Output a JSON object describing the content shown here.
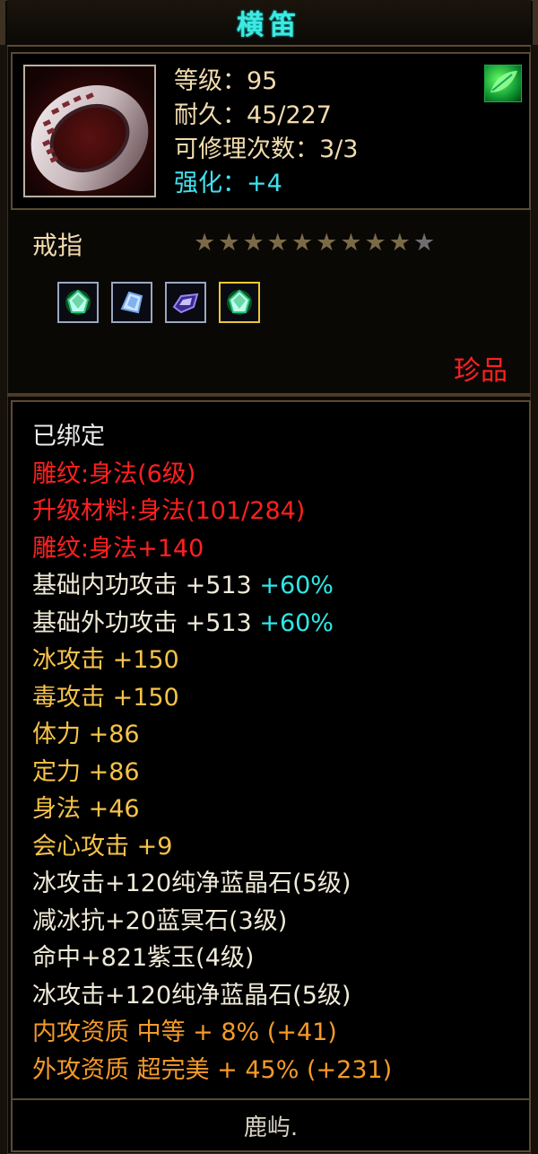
{
  "item": {
    "title": "横笛",
    "stats": [
      {
        "label": "等级",
        "sep": "：",
        "value": "95"
      },
      {
        "label": "耐久",
        "sep": "：",
        "value": "45/227"
      },
      {
        "label": "可修理次数",
        "sep": "：",
        "value": "3/3"
      },
      {
        "label": "强化",
        "sep": "：",
        "value": "+4"
      }
    ],
    "icon": "ring-icon",
    "skill_icon": "leaf-icon",
    "name": "戒指",
    "stars_total": 10,
    "stars_filled": 9,
    "gems": [
      {
        "icon": "green-gem-icon",
        "color": "#2fbf7a",
        "selected": false
      },
      {
        "icon": "blue-crystal-icon",
        "color": "#6fa8e8",
        "selected": false
      },
      {
        "icon": "purple-jade-icon",
        "color": "#6a48c8",
        "selected": false
      },
      {
        "icon": "green-gem-icon",
        "color": "#2fbf7a",
        "selected": true
      }
    ],
    "rarity": "珍品"
  },
  "attributes": [
    {
      "text": "已绑定",
      "color": "white"
    },
    {
      "text": "雕纹:身法(6级)",
      "color": "red"
    },
    {
      "text": "升级材料:身法(101/284)",
      "color": "red"
    },
    {
      "text": "雕纹:身法+140",
      "color": "red"
    },
    {
      "text": "基础内功攻击 +513 ",
      "extra": "+60%",
      "color": "white2"
    },
    {
      "text": "基础外功攻击 +513 ",
      "extra": "+60%",
      "color": "white2"
    },
    {
      "text": "冰攻击 +150",
      "color": "gold"
    },
    {
      "text": "毒攻击 +150",
      "color": "gold"
    },
    {
      "text": "体力 +86",
      "color": "gold"
    },
    {
      "text": "定力 +86",
      "color": "gold"
    },
    {
      "text": "身法 +46",
      "color": "gold"
    },
    {
      "text": "会心攻击 +9",
      "color": "gold"
    },
    {
      "text": "冰攻击+120纯净蓝晶石(5级)",
      "color": "white2"
    },
    {
      "text": "减冰抗+20蓝冥石(3级)",
      "color": "white2"
    },
    {
      "text": "命中+821紫玉(4级)",
      "color": "white2"
    },
    {
      "text": "冰攻击+120纯净蓝晶石(5级)",
      "color": "white2"
    },
    {
      "text": "内攻资质 中等 + 8% (+41)",
      "color": "orange"
    },
    {
      "text": "外攻资质 超完美 + 45% (+231)",
      "color": "orange"
    }
  ],
  "footer": {
    "name": "鹿屿."
  },
  "colors": {
    "white": "#ececec",
    "red": "#ff2020",
    "gold": "#f6c24a",
    "white2": "#f0ead8",
    "orange": "#f59a2a",
    "cyan": "#2ee8e8",
    "title": "#3fe8e0"
  }
}
